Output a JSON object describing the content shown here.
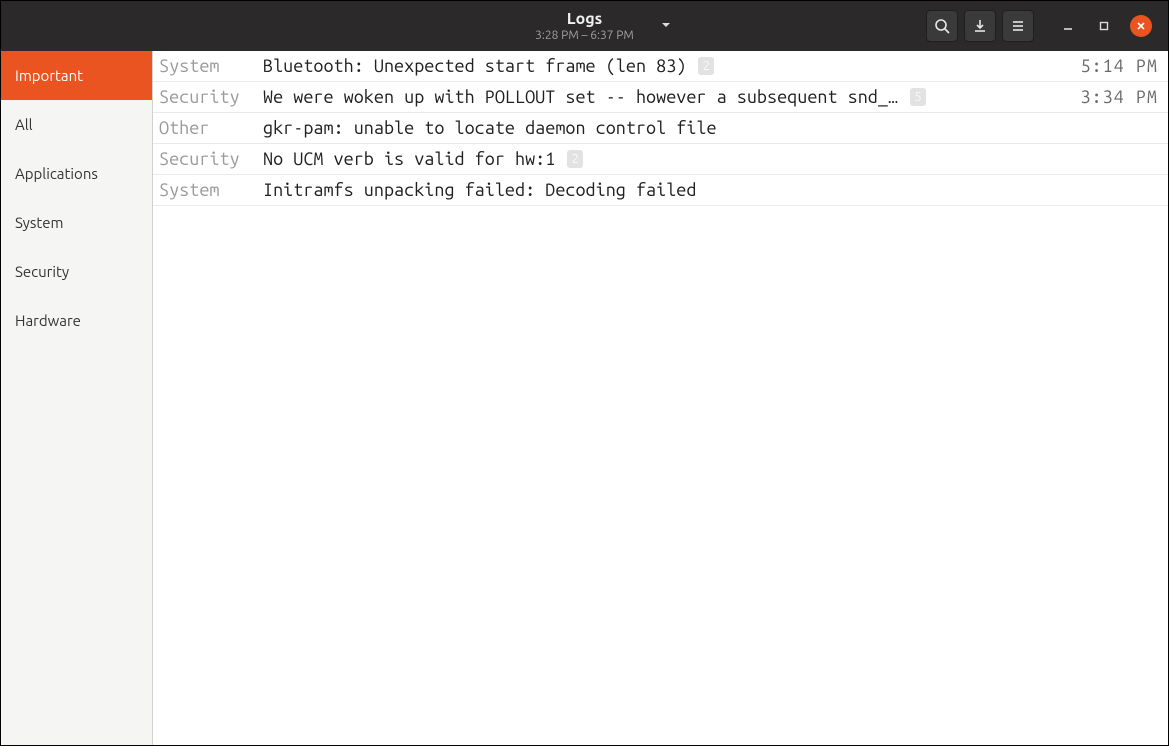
{
  "header": {
    "title": "Logs",
    "subtitle": "3:28 PM –  6:37 PM"
  },
  "sidebar": {
    "items": [
      {
        "label": "Important",
        "selected": true
      },
      {
        "label": "All",
        "selected": false
      },
      {
        "label": "Applications",
        "selected": false
      },
      {
        "label": "System",
        "selected": false
      },
      {
        "label": "Security",
        "selected": false
      },
      {
        "label": "Hardware",
        "selected": false
      }
    ]
  },
  "logs": [
    {
      "category": "System",
      "message": "Bluetooth: Unexpected start frame (len 83)",
      "badge": "2",
      "time": "5:14 PM"
    },
    {
      "category": "Security",
      "message": "We were woken up with POLLOUT set -- however a subsequent snd_…",
      "badge": "5",
      "time": "3:34 PM"
    },
    {
      "category": "Other",
      "message": "gkr-pam: unable to locate daemon control file",
      "badge": "",
      "time": ""
    },
    {
      "category": "Security",
      "message": "No UCM verb is valid for hw:1",
      "badge": "2",
      "time": ""
    },
    {
      "category": "System",
      "message": "Initramfs unpacking failed: Decoding failed",
      "badge": "",
      "time": ""
    }
  ],
  "colors": {
    "accent": "#e95420",
    "titlebar": "#2b2929"
  }
}
